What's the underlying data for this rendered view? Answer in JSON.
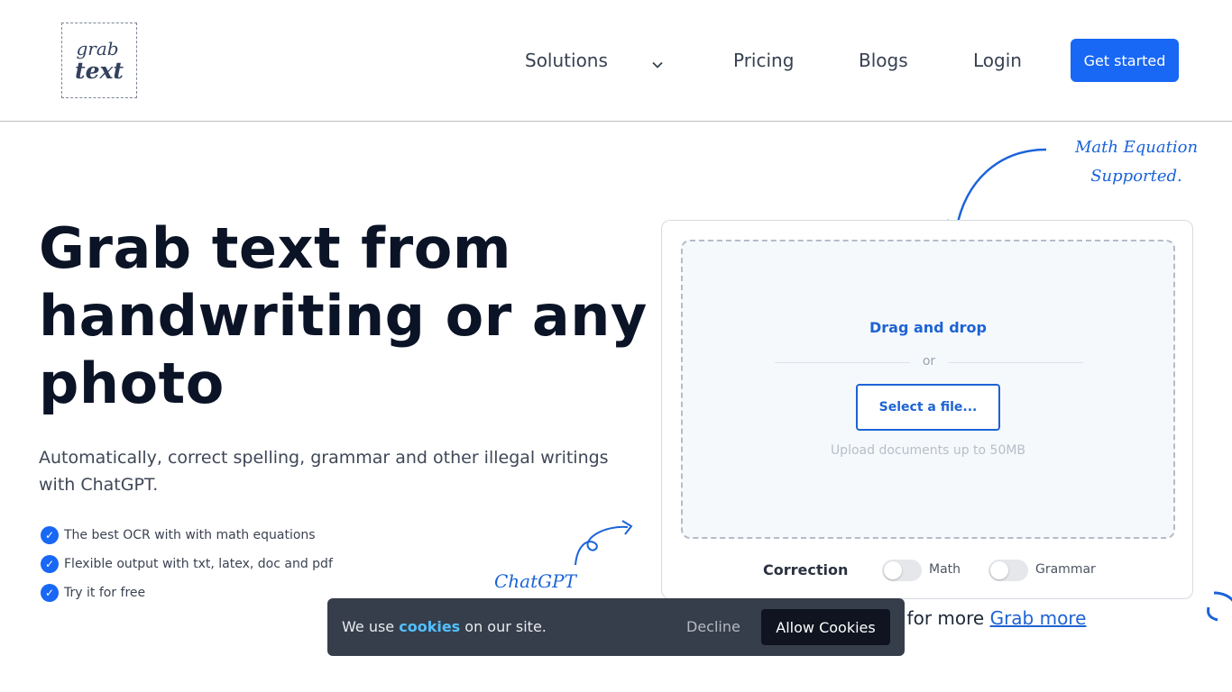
{
  "brand": {
    "logo_line1": "grab",
    "logo_line2": "text"
  },
  "nav": {
    "solutions": "Solutions",
    "pricing": "Pricing",
    "blogs": "Blogs",
    "login": "Login",
    "get_started": "Get started"
  },
  "hero": {
    "title": "Grab text from handwriting or any photo",
    "subtitle": "Automatically, correct spelling, grammar and other illegal writings with ChatGPT.",
    "features": [
      "The best OCR with with math equations",
      "Flexible output with txt, latex, doc and pdf",
      "Try it for free"
    ],
    "chatgpt_note": "ChatGPT"
  },
  "math_note": {
    "line1": "Math Equation",
    "line2": "Supported."
  },
  "uploader": {
    "drag_label": "Drag and drop",
    "or": "or",
    "select_button": "Select a file...",
    "hint": "Upload documents up to 50MB",
    "correction_label": "Correction",
    "toggles": [
      {
        "label": "Math",
        "on": false
      },
      {
        "label": "Grammar",
        "on": false
      }
    ]
  },
  "grab_more": {
    "prefix": "t, for more ",
    "link": "Grab more"
  },
  "cookie": {
    "prefix": "We use ",
    "link": "cookies",
    "suffix": " on our site.",
    "decline": "Decline",
    "allow": "Allow Cookies"
  },
  "colors": {
    "accent": "#1867f5",
    "note": "#1a63d8",
    "cookie_bg": "#363e4b"
  }
}
